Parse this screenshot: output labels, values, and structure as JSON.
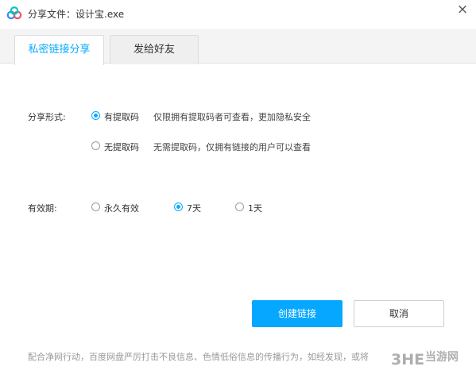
{
  "window": {
    "title": "分享文件：设计宝.exe",
    "close_glyph": "×"
  },
  "tabs": [
    {
      "label": "私密链接分享",
      "active": true
    },
    {
      "label": "发给好友",
      "active": false
    }
  ],
  "share_form": {
    "label": "分享形式:",
    "options": [
      {
        "label": "有提取码",
        "desc": "仅限拥有提取码者可查看，更加隐私安全",
        "checked": true
      },
      {
        "label": "无提取码",
        "desc": "无需提取码，仅拥有链接的用户可以查看",
        "checked": false
      }
    ]
  },
  "validity": {
    "label": "有效期:",
    "options": [
      {
        "label": "永久有效",
        "checked": false
      },
      {
        "label": "7天",
        "checked": true
      },
      {
        "label": "1天",
        "checked": false
      }
    ]
  },
  "buttons": {
    "create": "创建链接",
    "cancel": "取消"
  },
  "footer": "配合净网行动，百度网盘严厉打击不良信息、色情低俗信息的传播行为，如经发现，或将",
  "watermark": {
    "text": "当游网"
  },
  "colors": {
    "accent": "#09aaff",
    "primary_button": "#06a7ff"
  }
}
